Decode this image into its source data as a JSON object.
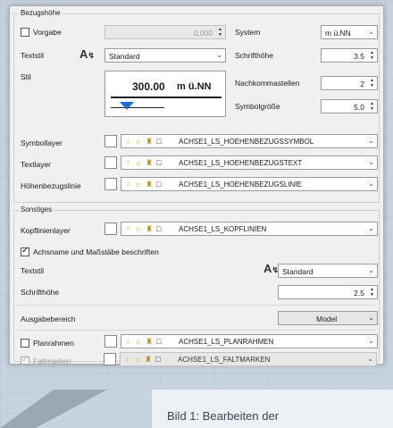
{
  "groups": {
    "bezugshoehe": "Bezugshöhe",
    "sonstiges": "Sonstiges"
  },
  "vorgabe": {
    "label": "Vorgabe",
    "checked": false,
    "value": "0,000"
  },
  "system": {
    "label": "System",
    "value": "m ü.NN"
  },
  "textstil": {
    "label": "Textstil",
    "value": "Standard"
  },
  "schrifthoehe": {
    "label": "Schrifthöhe",
    "value": "3.5"
  },
  "stil": {
    "label": "Stil",
    "preview_value": "300.00",
    "preview_unit": "m ü.NN"
  },
  "nachkommastellen": {
    "label": "Nachkommastellen",
    "value": "2"
  },
  "symbolgroesse": {
    "label": "Symbolgröße",
    "value": "5.0"
  },
  "layers": [
    {
      "label": "Symbollayer",
      "name": "ACHSE1_LS_HOEHENBEZUGSSYMBOL"
    },
    {
      "label": "Textlayer",
      "name": "ACHSE1_LS_HOEHENBEZUGSTEXT"
    },
    {
      "label": "Höhenbezugslinie",
      "name": "ACHSE1_LS_HOEHENBEZUGSLINIE"
    }
  ],
  "kopflinienlayer": {
    "label": "Kopflinienlayer",
    "name": "ACHSE1_LS_KOPFLINIEN"
  },
  "beschriften": {
    "label": "Achsname und Maßstäbe beschriften",
    "checked": true
  },
  "textstil2": {
    "label": "Textstil",
    "value": "Standard"
  },
  "schrifthoehe2": {
    "label": "Schrifthöhe",
    "value": "2.5"
  },
  "ausgabebereich": {
    "label": "Ausgabebereich",
    "value": "Model"
  },
  "planrahmen": {
    "label": "Planrahmen",
    "checked": false,
    "name": "ACHSE1_LS_PLANRAHMEN"
  },
  "faltmarken": {
    "label": "Faltmarken",
    "checked": true,
    "name": "ACHSE1_LS_FALTMARKEN"
  },
  "caption": "Bild 1: Bearbeiten der",
  "colors": {
    "blue_arrow": "#1f6fd0",
    "bulb": "#d8b100"
  }
}
